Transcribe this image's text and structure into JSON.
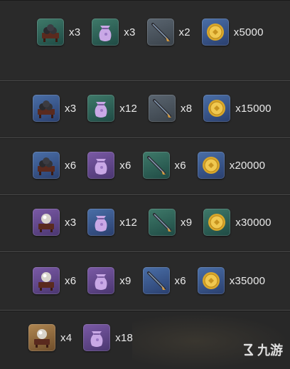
{
  "rows": [
    {
      "items": [
        {
          "icon": "incense-burner-icon",
          "slot": "green",
          "qty": "x3"
        },
        {
          "icon": "pouch-icon",
          "slot": "green",
          "qty": "x3"
        },
        {
          "icon": "arrow-blade-icon",
          "slot": "grey",
          "qty": "x2"
        },
        {
          "icon": "coin-icon",
          "slot": "blue",
          "qty": "x5000"
        }
      ]
    },
    {
      "items": [
        {
          "icon": "incense-burner-icon",
          "slot": "blue",
          "qty": "x3"
        },
        {
          "icon": "pouch-icon",
          "slot": "green",
          "qty": "x12"
        },
        {
          "icon": "arrow-blade-icon",
          "slot": "grey",
          "qty": "x8"
        },
        {
          "icon": "coin-icon",
          "slot": "blue",
          "qty": "x15000"
        }
      ]
    },
    {
      "items": [
        {
          "icon": "incense-burner-icon",
          "slot": "blue",
          "qty": "x6"
        },
        {
          "icon": "pouch-icon",
          "slot": "purple",
          "qty": "x6"
        },
        {
          "icon": "arrow-blade-icon",
          "slot": "green",
          "qty": "x6"
        },
        {
          "icon": "coin-icon",
          "slot": "blue",
          "qty": "x20000"
        }
      ]
    },
    {
      "items": [
        {
          "icon": "pearl-stand-icon",
          "slot": "purple",
          "qty": "x3"
        },
        {
          "icon": "pouch-icon",
          "slot": "blue",
          "qty": "x12"
        },
        {
          "icon": "arrow-blade-icon",
          "slot": "green",
          "qty": "x9"
        },
        {
          "icon": "coin-icon",
          "slot": "green",
          "qty": "x30000"
        }
      ]
    },
    {
      "items": [
        {
          "icon": "pearl-stand-icon",
          "slot": "purple",
          "qty": "x6"
        },
        {
          "icon": "pouch-icon",
          "slot": "purple",
          "qty": "x9"
        },
        {
          "icon": "arrow-blade-icon",
          "slot": "blue",
          "qty": "x6"
        },
        {
          "icon": "coin-icon",
          "slot": "blue",
          "qty": "x35000"
        }
      ]
    },
    {
      "items": [
        {
          "icon": "pearl-stand-icon",
          "slot": "gold",
          "qty": "x4"
        },
        {
          "icon": "pouch-icon",
          "slot": "purple",
          "qty": "x18"
        }
      ]
    }
  ],
  "watermark": {
    "text": "九游"
  }
}
